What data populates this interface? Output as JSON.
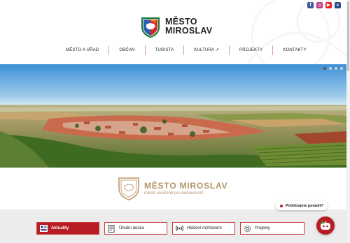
{
  "header": {
    "title_line1": "MĚSTO",
    "title_line2": "MIROSLAV",
    "social": [
      "facebook-icon",
      "instagram-icon",
      "youtube-icon",
      "search-icon"
    ]
  },
  "nav": {
    "items": [
      {
        "label": "MĚSTO A ÚŘAD"
      },
      {
        "label": "OBČAN"
      },
      {
        "label": "TURISTA"
      },
      {
        "label": "KULTURA ↗"
      },
      {
        "label": "PROJEKTY"
      },
      {
        "label": "KONTAKTY"
      }
    ]
  },
  "slider": {
    "slides": 4,
    "active": 1
  },
  "brand": {
    "name": "MĚSTO MIROSLAV",
    "tagline": "město otevřené pro budoucnost"
  },
  "quick_links": [
    {
      "label": "Aktuality",
      "active": true
    },
    {
      "label": "Úřední deska",
      "active": false
    },
    {
      "label": "Hlášení rozhlasem",
      "active": false
    },
    {
      "label": "Projekty",
      "active": false
    }
  ],
  "help": {
    "label": "Potřebujete poradit?"
  },
  "colors": {
    "accent": "#b81d25",
    "gold": "#b4946a"
  }
}
